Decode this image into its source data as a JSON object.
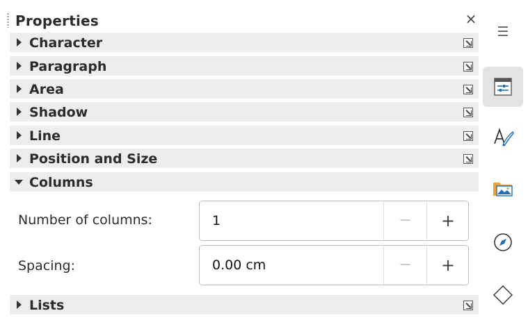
{
  "panel": {
    "title": "Properties",
    "close_glyph": "×"
  },
  "sections": [
    {
      "label": "Character",
      "expanded": false
    },
    {
      "label": "Paragraph",
      "expanded": false
    },
    {
      "label": "Area",
      "expanded": false
    },
    {
      "label": "Shadow",
      "expanded": false
    },
    {
      "label": "Line",
      "expanded": false
    },
    {
      "label": "Position and Size",
      "expanded": false
    },
    {
      "label": "Columns",
      "expanded": true
    },
    {
      "label": "Lists",
      "expanded": false
    }
  ],
  "columns": {
    "number_label": "Number of columns:",
    "number_value": "1",
    "spacing_label": "Spacing:",
    "spacing_value": "0.00 cm",
    "minus_glyph": "−",
    "plus_glyph": "+"
  },
  "sidebar": {
    "menu_glyph": "≡",
    "tabs": [
      {
        "name": "properties-tab",
        "icon": "properties-icon",
        "active": true
      },
      {
        "name": "styles-tab",
        "icon": "styles-icon",
        "active": false
      },
      {
        "name": "gallery-tab",
        "icon": "gallery-icon",
        "active": false
      },
      {
        "name": "navigator-tab",
        "icon": "navigator-icon",
        "active": false
      },
      {
        "name": "shapes-tab",
        "icon": "shapes-icon",
        "active": false
      }
    ]
  },
  "colors": {
    "section_bg": "#ededed",
    "accent_blue": "#1e6fb8",
    "folder_orange": "#e8a33c"
  }
}
